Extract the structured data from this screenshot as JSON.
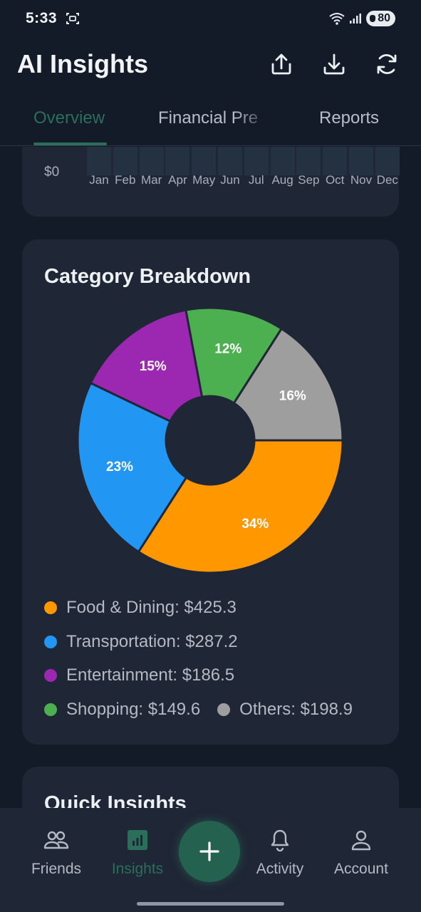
{
  "status_bar": {
    "time": "5:33",
    "battery": "80"
  },
  "app_bar": {
    "title": "AI Insights"
  },
  "tabs": [
    {
      "label": "Overview",
      "active": true
    },
    {
      "label": "Financial Pre",
      "active": false
    },
    {
      "label": "Reports",
      "active": false
    }
  ],
  "monthly_chart": {
    "zero_label": "$0",
    "months": [
      "Jan",
      "Feb",
      "Mar",
      "Apr",
      "May",
      "Jun",
      "Jul",
      "Aug",
      "Sep",
      "Oct",
      "Nov",
      "Dec"
    ]
  },
  "category_card": {
    "title": "Category Breakdown",
    "legend": [
      {
        "label": "Food & Dining: $425.3",
        "color": "#ff9800"
      },
      {
        "label": "Transportation: $287.2",
        "color": "#2196f3"
      },
      {
        "label": "Entertainment: $186.5",
        "color": "#9c27b0"
      },
      {
        "label": "Shopping: $149.6",
        "color": "#4caf50"
      },
      {
        "label": "Others: $198.9",
        "color": "#9e9e9e"
      }
    ]
  },
  "chart_data": {
    "type": "pie",
    "title": "Category Breakdown",
    "donut": true,
    "slices": [
      {
        "name": "Food & Dining",
        "value": 425.3,
        "percent_label": "34%",
        "color": "#ff9800"
      },
      {
        "name": "Transportation",
        "value": 287.2,
        "percent_label": "23%",
        "color": "#2196f3"
      },
      {
        "name": "Entertainment",
        "value": 186.5,
        "percent_label": "15%",
        "color": "#9c27b0"
      },
      {
        "name": "Shopping",
        "value": 149.6,
        "percent_label": "12%",
        "color": "#4caf50"
      },
      {
        "name": "Others",
        "value": 198.9,
        "percent_label": "16%",
        "color": "#9e9e9e"
      }
    ]
  },
  "quick_card": {
    "title": "Quick Insights"
  },
  "bottom_nav": {
    "items": [
      {
        "label": "Friends",
        "icon": "people-icon",
        "active": false
      },
      {
        "label": "Insights",
        "icon": "bar-chart-icon",
        "active": true
      },
      {
        "label": "Activity",
        "icon": "bell-icon",
        "active": false
      },
      {
        "label": "Account",
        "icon": "person-icon",
        "active": false
      }
    ],
    "fab_icon": "plus-icon"
  },
  "colors": {
    "accent": "#2b6e5a",
    "background": "#131a28",
    "card": "#1f2635"
  }
}
